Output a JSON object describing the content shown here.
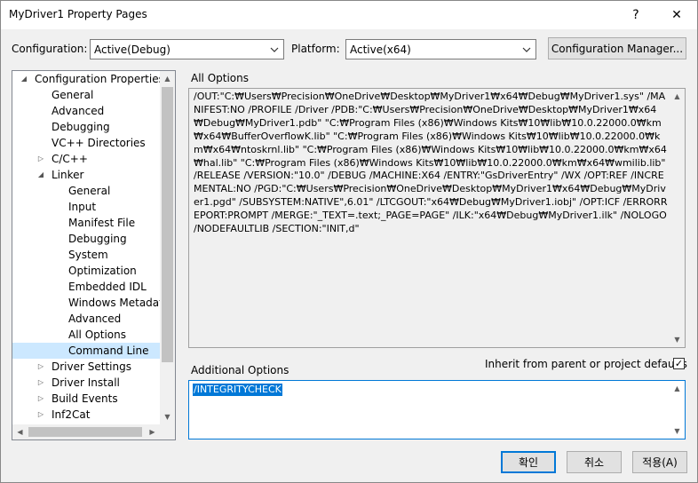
{
  "window": {
    "title": "MyDriver1 Property Pages",
    "help_glyph": "?",
    "close_glyph": "✕"
  },
  "config": {
    "configuration_label": "Configuration:",
    "configuration_value": "Active(Debug)",
    "platform_label": "Platform:",
    "platform_value": "Active(x64)",
    "manager_button": "Configuration Manager..."
  },
  "tree": {
    "items": [
      {
        "label": "Configuration Properties",
        "expander": "◢"
      },
      {
        "label": "General"
      },
      {
        "label": "Advanced"
      },
      {
        "label": "Debugging"
      },
      {
        "label": "VC++ Directories"
      },
      {
        "label": "C/C++",
        "expander": "▷"
      },
      {
        "label": "Linker",
        "expander": "◢"
      },
      {
        "label": "General"
      },
      {
        "label": "Input"
      },
      {
        "label": "Manifest File"
      },
      {
        "label": "Debugging"
      },
      {
        "label": "System"
      },
      {
        "label": "Optimization"
      },
      {
        "label": "Embedded IDL"
      },
      {
        "label": "Windows Metadata"
      },
      {
        "label": "Advanced"
      },
      {
        "label": "All Options"
      },
      {
        "label": "Command Line",
        "selected": true
      },
      {
        "label": "Driver Settings",
        "expander": "▷"
      },
      {
        "label": "Driver Install",
        "expander": "▷"
      },
      {
        "label": "Build Events",
        "expander": "▷"
      },
      {
        "label": "Inf2Cat",
        "expander": "▷"
      }
    ]
  },
  "all_options": {
    "label": "All Options",
    "text": "/OUT:\"C:₩Users₩Precision₩OneDrive₩Desktop₩MyDriver1₩x64₩Debug₩MyDriver1.sys\" /MANIFEST:NO /PROFILE /Driver /PDB:\"C:₩Users₩Precision₩OneDrive₩Desktop₩MyDriver1₩x64₩Debug₩MyDriver1.pdb\" \"C:₩Program Files (x86)₩Windows Kits₩10₩lib₩10.0.22000.0₩km₩x64₩BufferOverflowK.lib\" \"C:₩Program Files (x86)₩Windows Kits₩10₩lib₩10.0.22000.0₩km₩x64₩ntoskrnl.lib\" \"C:₩Program Files (x86)₩Windows Kits₩10₩lib₩10.0.22000.0₩km₩x64₩hal.lib\" \"C:₩Program Files (x86)₩Windows Kits₩10₩lib₩10.0.22000.0₩km₩x64₩wmilib.lib\" /RELEASE /VERSION:\"10.0\" /DEBUG /MACHINE:X64 /ENTRY:\"GsDriverEntry\" /WX /OPT:REF /INCREMENTAL:NO /PGD:\"C:₩Users₩Precision₩OneDrive₩Desktop₩MyDriver1₩x64₩Debug₩MyDriver1.pgd\" /SUBSYSTEM:NATIVE\",6.01\" /LTCGOUT:\"x64₩Debug₩MyDriver1.iobj\" /OPT:ICF /ERRORREPORT:PROMPT /MERGE:\"_TEXT=.text;_PAGE=PAGE\" /ILK:\"x64₩Debug₩MyDriver1.ilk\" /NOLOGO /NODEFAULTLIB /SECTION:\"INIT,d\""
  },
  "additional_options": {
    "label": "Additional Options",
    "value": "/INTEGRITYCHECK",
    "inherit_label": "Inherit from parent or project defaults",
    "inherit_checked": true,
    "check_glyph": "✓"
  },
  "buttons": {
    "ok": "확인",
    "cancel": "취소",
    "apply": "적용(A)"
  },
  "glyphs": {
    "chevron_down": "∨",
    "scroll_up": "▲",
    "scroll_down": "▼",
    "scroll_left": "◀",
    "scroll_right": "▶"
  }
}
